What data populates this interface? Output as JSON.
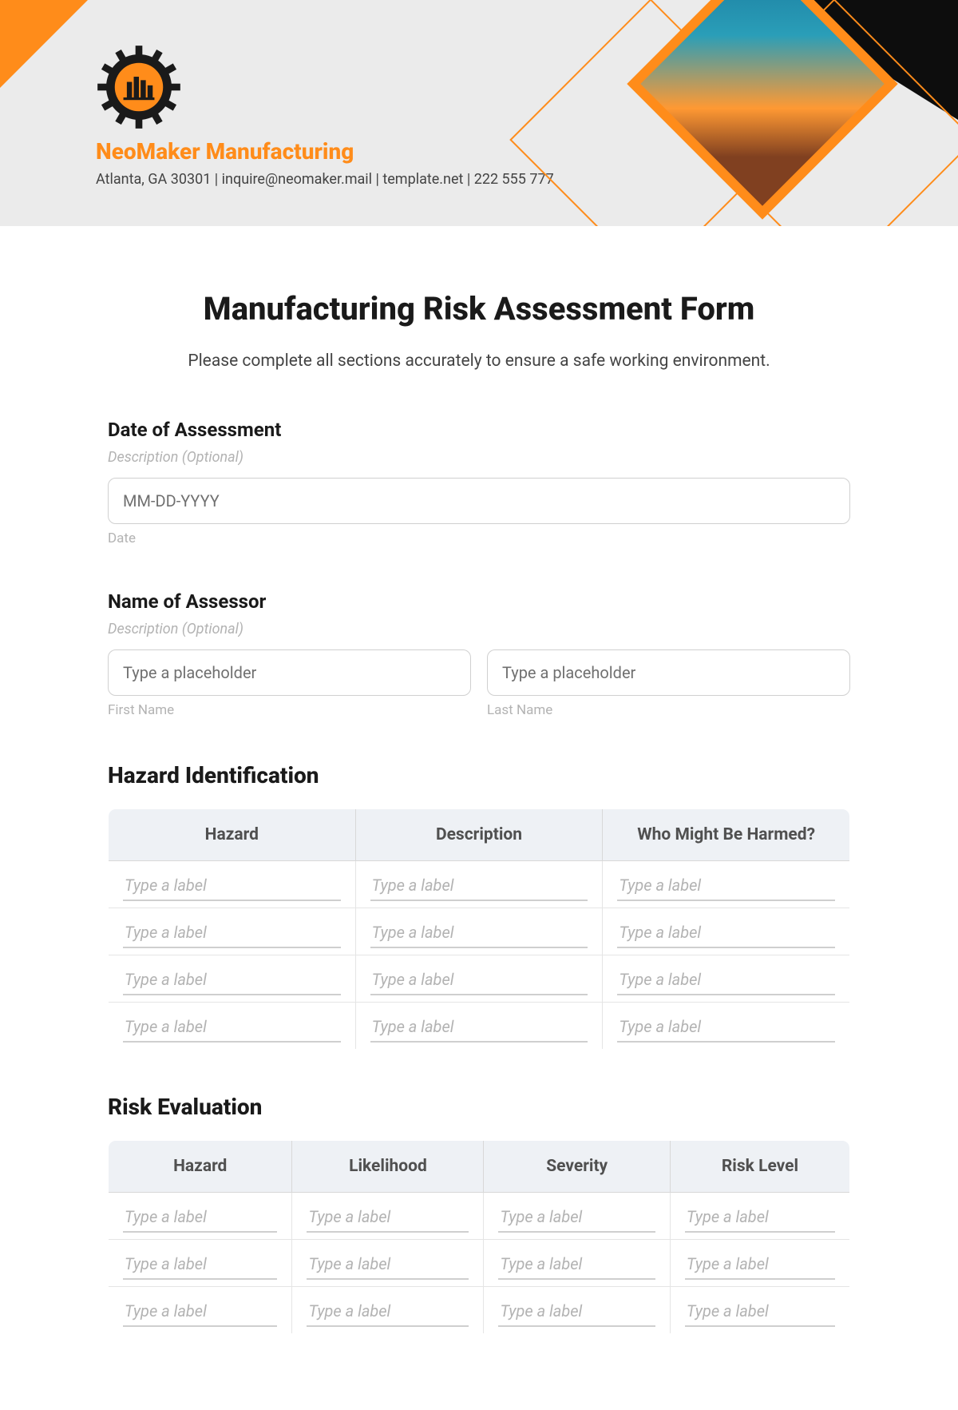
{
  "header": {
    "company_name": "NeoMaker Manufacturing",
    "company_info": "Atlanta, GA 30301 | inquire@neomaker.mail | template.net | 222 555 777"
  },
  "form": {
    "title": "Manufacturing Risk Assessment Form",
    "subtitle": "Please complete all sections accurately to ensure a safe working environment.",
    "date": {
      "label": "Date of Assessment",
      "description": "Description (Optional)",
      "placeholder": "MM-DD-YYYY",
      "sublabel": "Date"
    },
    "assessor": {
      "label": "Name of Assessor",
      "description": "Description (Optional)",
      "first_ph": "Type a placeholder",
      "last_ph": "Type a placeholder",
      "first_sub": "First Name",
      "last_sub": "Last Name"
    },
    "hazard_section": {
      "title": "Hazard Identification",
      "headers": [
        "Hazard",
        "Description",
        "Who Might Be Harmed?"
      ],
      "cell_ph": "Type a label",
      "rows": 4
    },
    "risk_section": {
      "title": "Risk Evaluation",
      "headers": [
        "Hazard",
        "Likelihood",
        "Severity",
        "Risk Level"
      ],
      "cell_ph": "Type a label",
      "rows": 3
    }
  }
}
